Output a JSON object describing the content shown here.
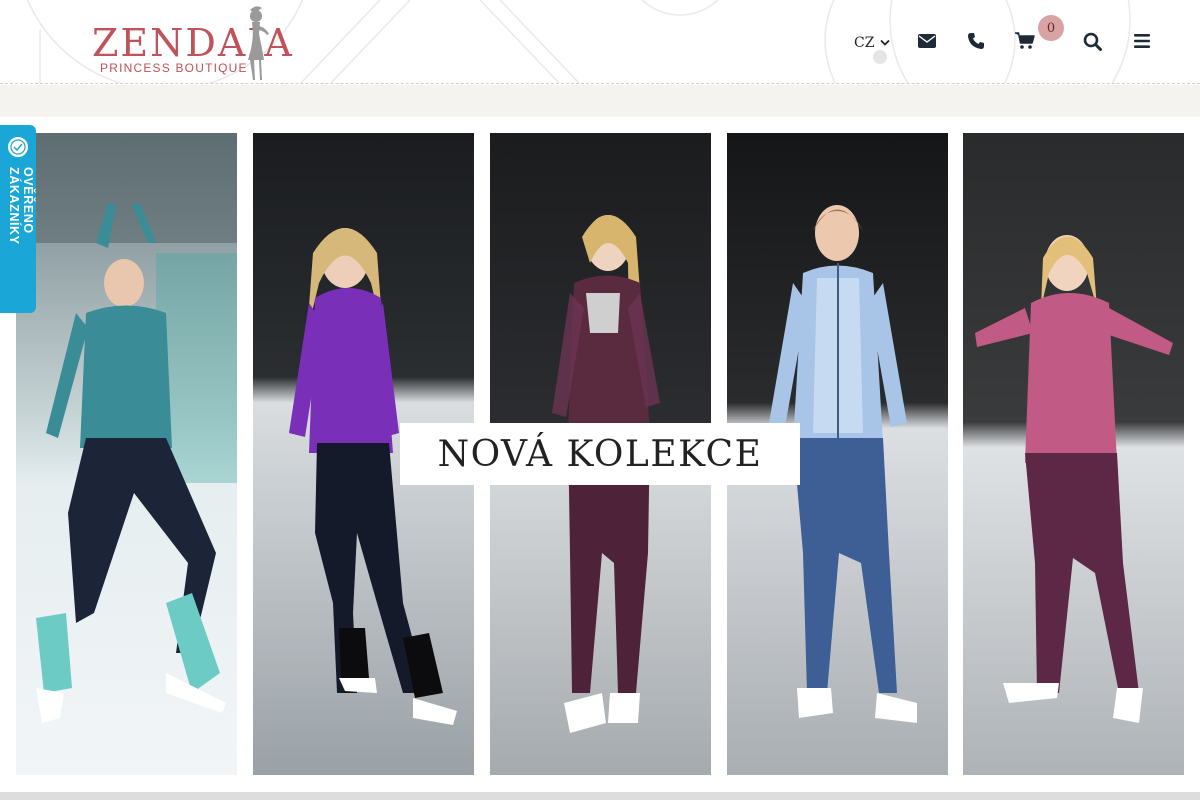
{
  "header": {
    "logo": {
      "brand": "ZENDAIA",
      "tagline": "PRINCESS BOUTIQUE"
    },
    "language": {
      "selected": "CZ",
      "icon": "chevron-down-icon"
    },
    "icons": [
      "envelope-icon",
      "phone-icon",
      "cart-icon",
      "search-icon",
      "menu-icon"
    ],
    "cart_count": "0"
  },
  "banner": {
    "headline": "NOVÁ KOLEKCE",
    "panels": [
      {
        "top_color": "#2f7f8e"
      },
      {
        "top_color": "#7a2fb8"
      },
      {
        "top_color": "#5a2a3f"
      },
      {
        "top_color": "#a8c4e6"
      },
      {
        "top_color": "#c25a86"
      }
    ]
  },
  "verified_tab": {
    "label": "OVĚŘENO ZÁKAZNÍKY"
  },
  "colors": {
    "brand": "#c0525a",
    "badge": "#d9a3a3",
    "verified": "#1aa6d6",
    "subbar": "#f4f3f0"
  }
}
